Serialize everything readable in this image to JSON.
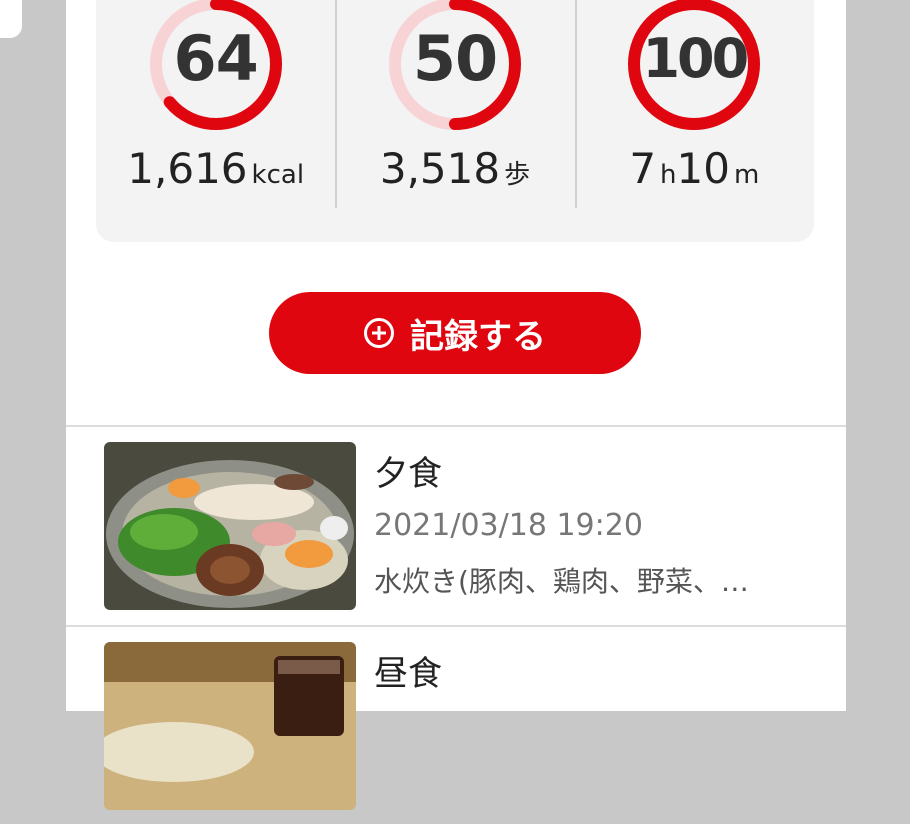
{
  "stats": [
    {
      "score": "64",
      "score_fraction": 0.64,
      "value": "1,616",
      "unit": "kcal"
    },
    {
      "score": "50",
      "score_fraction": 0.5,
      "value": "3,518",
      "unit": "歩"
    },
    {
      "score": "100",
      "score_fraction": 1.0,
      "value_h": "7",
      "unit_h": "h",
      "value_m": "10",
      "unit_m": "m"
    }
  ],
  "record_button": {
    "label": "記録する",
    "icon": "plus-circle-icon"
  },
  "meals": [
    {
      "title": "夕食",
      "datetime": "2021/03/18 19:20",
      "description": "水炊き(豚肉、鶏肉、野菜、…"
    },
    {
      "title": "昼食",
      "datetime": "",
      "description": ""
    }
  ],
  "colors": {
    "accent": "#e0060f",
    "ring_track": "#f7d3d6"
  }
}
